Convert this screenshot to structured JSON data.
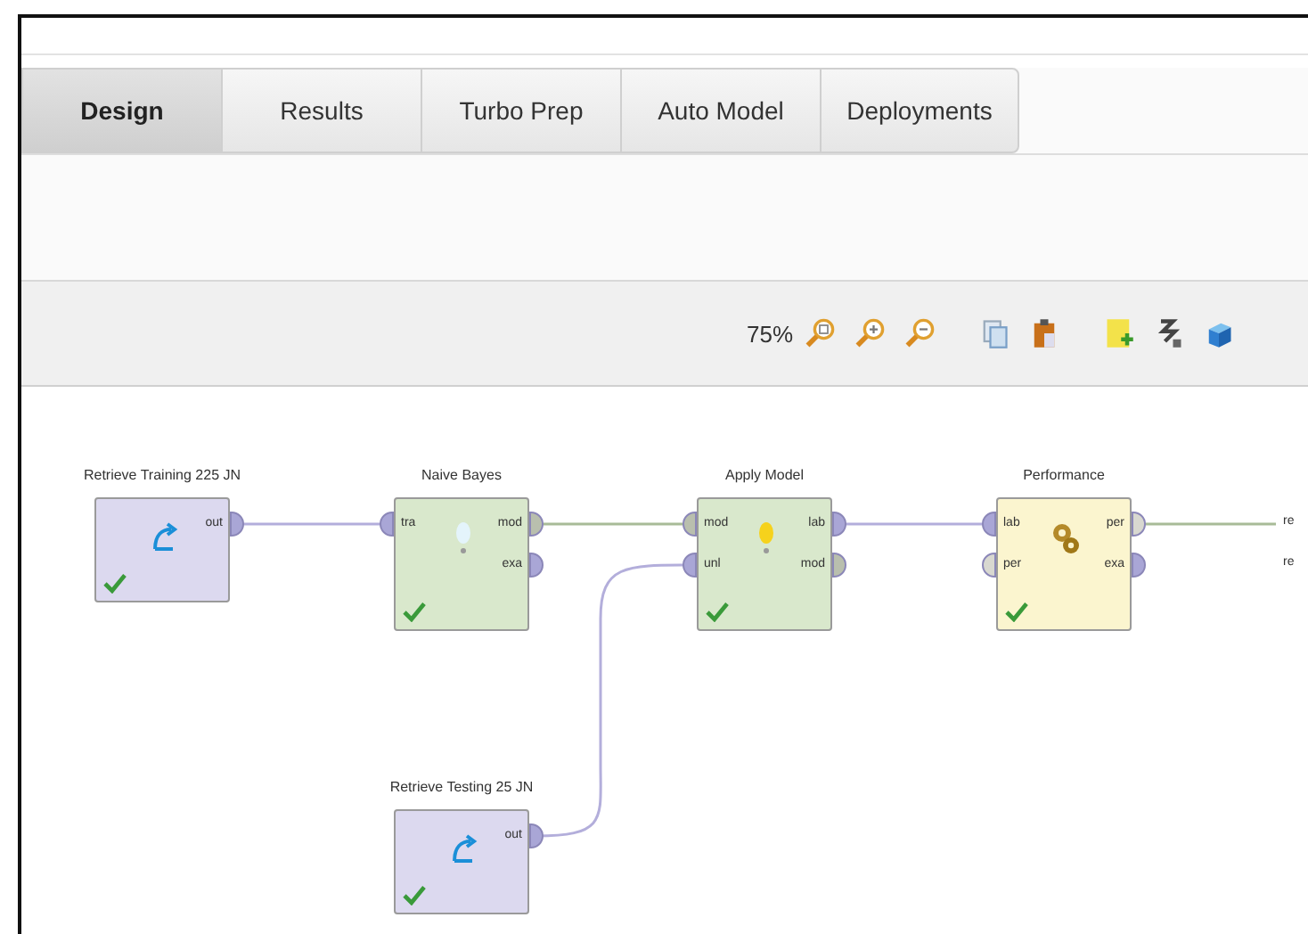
{
  "tabs": [
    {
      "label": "Design",
      "selected": true
    },
    {
      "label": "Results",
      "selected": false
    },
    {
      "label": "Turbo Prep",
      "selected": false
    },
    {
      "label": "Auto Model",
      "selected": false
    },
    {
      "label": "Deployments",
      "selected": false
    }
  ],
  "toolbar": {
    "zoom": "75%"
  },
  "operators": [
    {
      "name": "Retrieve Training 225 JN",
      "kind": "retrieve",
      "ok": true,
      "outputs": [
        {
          "label": "out",
          "color": "#a9a6d6"
        }
      ]
    },
    {
      "name": "Naive Bayes",
      "kind": "learner",
      "ok": true,
      "inputs": [
        {
          "label": "tra",
          "color": "#a9a6d6"
        }
      ],
      "outputs": [
        {
          "label": "mod",
          "color": "#b9bfae"
        },
        {
          "label": "exa",
          "color": "#a9a6d6"
        }
      ]
    },
    {
      "name": "Apply Model",
      "kind": "apply",
      "ok": true,
      "inputs": [
        {
          "label": "mod",
          "color": "#b9bfae"
        },
        {
          "label": "unl",
          "color": "#a9a6d6"
        }
      ],
      "outputs": [
        {
          "label": "lab",
          "color": "#a9a6d6"
        },
        {
          "label": "mod",
          "color": "#b9bfae"
        }
      ]
    },
    {
      "name": "Performance",
      "kind": "performance",
      "ok": true,
      "inputs": [
        {
          "label": "lab",
          "color": "#a9a6d6"
        },
        {
          "label": "per",
          "color": "#d8d8d0"
        }
      ],
      "outputs": [
        {
          "label": "per",
          "color": "#d8d8d0"
        },
        {
          "label": "exa",
          "color": "#a9a6d6"
        }
      ]
    },
    {
      "name": "Retrieve Testing 25 JN",
      "kind": "retrieve",
      "ok": true,
      "outputs": [
        {
          "label": "out",
          "color": "#a9a6d6"
        }
      ]
    }
  ],
  "results": [
    "re",
    "re"
  ]
}
